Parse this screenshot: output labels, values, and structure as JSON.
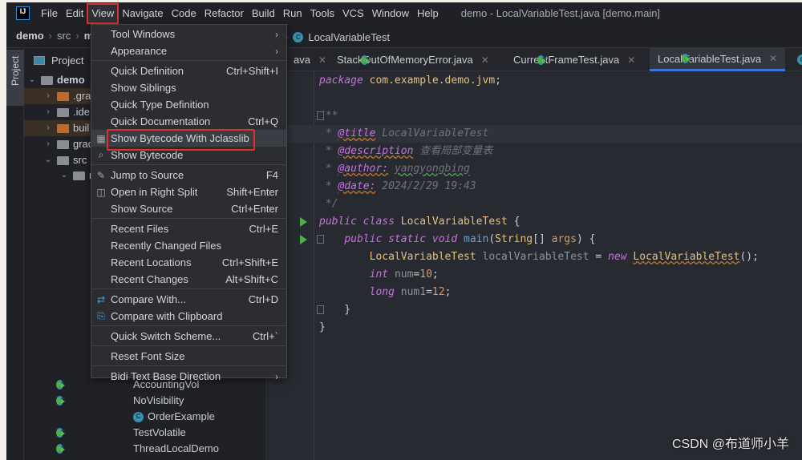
{
  "app": {
    "title": "demo - LocalVariableTest.java [demo.main]",
    "logo": "IJ"
  },
  "menubar": [
    "File",
    "Edit",
    "View",
    "Navigate",
    "Code",
    "Refactor",
    "Build",
    "Run",
    "Tools",
    "VCS",
    "Window",
    "Help"
  ],
  "breadcrumb": {
    "items": [
      "demo",
      "src",
      "m"
    ],
    "class": "LocalVariableTest"
  },
  "project": {
    "title": "Project",
    "strip_label": "Project",
    "tree": [
      {
        "label": "demo",
        "bold": true
      },
      {
        "label": ".gra"
      },
      {
        "label": ".ide"
      },
      {
        "label": "buil"
      },
      {
        "label": "grad"
      },
      {
        "label": "src"
      },
      {
        "label": "m"
      }
    ],
    "classes": [
      "AccountingVol",
      "NoVisibility",
      "OrderExample",
      "TestVolatile",
      "ThreadLocalDemo"
    ]
  },
  "tabs": [
    {
      "label": "ava"
    },
    {
      "label": "StackOutOfMemoryError.java"
    },
    {
      "label": "CurrentFrameTest.java"
    },
    {
      "label": "LocalVariableTest.java",
      "active": true
    }
  ],
  "code": [
    [
      [
        "kw",
        "package"
      ],
      [
        "pl",
        " "
      ],
      [
        "pk",
        "com.example.demo.jvm"
      ],
      [
        "pl",
        ";"
      ]
    ],
    [],
    [
      [
        "cm",
        "/**"
      ]
    ],
    [
      [
        "cm",
        " * "
      ],
      [
        "tg",
        "@title"
      ],
      [
        "cm",
        " LocalVariableTest"
      ]
    ],
    [
      [
        "cm",
        " * "
      ],
      [
        "tg",
        "@description"
      ],
      [
        "cm",
        " 查看局部变量表"
      ]
    ],
    [
      [
        "cm",
        " * "
      ],
      [
        "tg",
        "@author:"
      ],
      [
        "cm",
        " "
      ],
      [
        "au",
        "yangyongbing"
      ]
    ],
    [
      [
        "cm",
        " * "
      ],
      [
        "tg",
        "@date:"
      ],
      [
        "cm",
        " 2024/2/29 19:43"
      ]
    ],
    [
      [
        "cm",
        " */"
      ]
    ],
    [
      [
        "kw",
        "public class "
      ],
      [
        "ty",
        "LocalVariableTest"
      ],
      [
        "pl",
        " {"
      ]
    ],
    [
      [
        "pl",
        "    "
      ],
      [
        "kw",
        "public static void "
      ],
      [
        "fn",
        "main"
      ],
      [
        "pl",
        "("
      ],
      [
        "ty",
        "String"
      ],
      [
        "pl",
        "[] "
      ],
      [
        "nm",
        "args"
      ],
      [
        "pl",
        ") {"
      ]
    ],
    [
      [
        "pl",
        "        "
      ],
      [
        "ty",
        "LocalVariableTest"
      ],
      [
        "vr",
        " localVariableTest "
      ],
      [
        "pl",
        "= "
      ],
      [
        "kw",
        "new "
      ],
      [
        "tyu",
        "LocalVariableTest"
      ],
      [
        "pl",
        "();"
      ]
    ],
    [
      [
        "pl",
        "        "
      ],
      [
        "kw",
        "int "
      ],
      [
        "vr",
        "num"
      ],
      [
        "pl",
        "="
      ],
      [
        "nm",
        "10"
      ],
      [
        "pl",
        ";"
      ]
    ],
    [
      [
        "pl",
        "        "
      ],
      [
        "kw",
        "long "
      ],
      [
        "vr",
        "num1"
      ],
      [
        "pl",
        "="
      ],
      [
        "nm",
        "12"
      ],
      [
        "pl",
        ";"
      ]
    ],
    [
      [
        "pl",
        "    }"
      ]
    ],
    [
      [
        "pl",
        "}"
      ]
    ]
  ],
  "view_menu": [
    {
      "label": "Tool Windows",
      "submenu": true
    },
    {
      "label": "Appearance",
      "submenu": true
    },
    "sep",
    {
      "label": "Quick Definition",
      "shortcut": "Ctrl+Shift+I"
    },
    {
      "label": "Show Siblings"
    },
    {
      "label": "Quick Type Definition"
    },
    {
      "label": "Quick Documentation",
      "shortcut": "Ctrl+Q"
    },
    {
      "label": "Show Bytecode With Jclasslib",
      "icon": "bytecode-grid-icon",
      "highlighted": true
    },
    {
      "label": "Show Bytecode",
      "icon": "bytecode-search-icon"
    },
    "sep",
    {
      "label": "Jump to Source",
      "shortcut": "F4",
      "icon": "pencil-icon"
    },
    {
      "label": "Open in Right Split",
      "shortcut": "Shift+Enter",
      "icon": "split-icon"
    },
    {
      "label": "Show Source",
      "shortcut": "Ctrl+Enter"
    },
    "sep",
    {
      "label": "Recent Files",
      "shortcut": "Ctrl+E"
    },
    {
      "label": "Recently Changed Files"
    },
    {
      "label": "Recent Locations",
      "shortcut": "Ctrl+Shift+E"
    },
    {
      "label": "Recent Changes",
      "shortcut": "Alt+Shift+C"
    },
    "sep",
    {
      "label": "Compare With...",
      "shortcut": "Ctrl+D",
      "icon": "compare-icon"
    },
    {
      "label": "Compare with Clipboard",
      "icon": "compare-clipboard-icon"
    },
    "sep",
    {
      "label": "Quick Switch Scheme...",
      "shortcut": "Ctrl+`"
    },
    "sep",
    {
      "label": "Reset Font Size"
    },
    "sep",
    {
      "label": "Bidi Text Base Direction",
      "submenu": true
    }
  ],
  "watermark": "CSDN @布道师小羊",
  "colors": {
    "highlight_box": "#e0302a",
    "active_tab_underline": "#3f75d6"
  }
}
